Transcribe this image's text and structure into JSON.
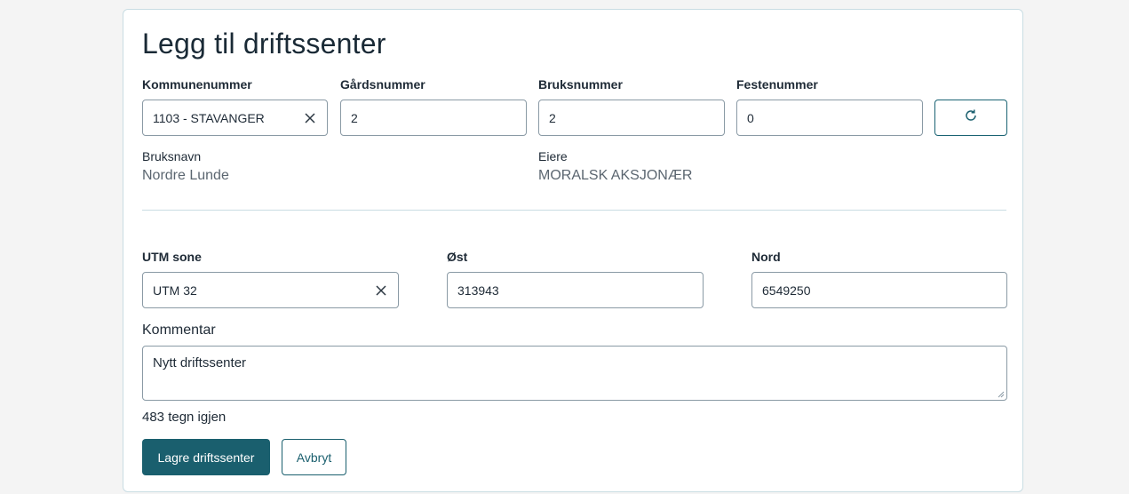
{
  "form": {
    "title": "Legg til driftssenter",
    "kommunenummer": {
      "label": "Kommunenummer",
      "value": "1103 - STAVANGER"
    },
    "gardsnummer": {
      "label": "Gårdsnummer",
      "value": "2"
    },
    "bruksnummer": {
      "label": "Bruksnummer",
      "value": "2"
    },
    "festenummer": {
      "label": "Festenummer",
      "value": "0"
    },
    "bruksnavn": {
      "label": "Bruksnavn",
      "value": "Nordre Lunde"
    },
    "eiere": {
      "label": "Eiere",
      "value": "MORALSK AKSJONÆR"
    },
    "utm_sone": {
      "label": "UTM sone",
      "value": "UTM 32"
    },
    "ost": {
      "label": "Øst",
      "value": "313943"
    },
    "nord": {
      "label": "Nord",
      "value": "6549250"
    },
    "kommentar": {
      "label": "Kommentar",
      "value": "Nytt driftssenter",
      "counter": "483 tegn igjen"
    },
    "save_label": "Lagre driftssenter",
    "cancel_label": "Avbryt"
  },
  "icons": {
    "clear": "close-icon",
    "refresh": "refresh-icon"
  },
  "colors": {
    "primary": "#1a5f6e",
    "border": "#8a9aa5",
    "card_border": "#c9dde3"
  }
}
